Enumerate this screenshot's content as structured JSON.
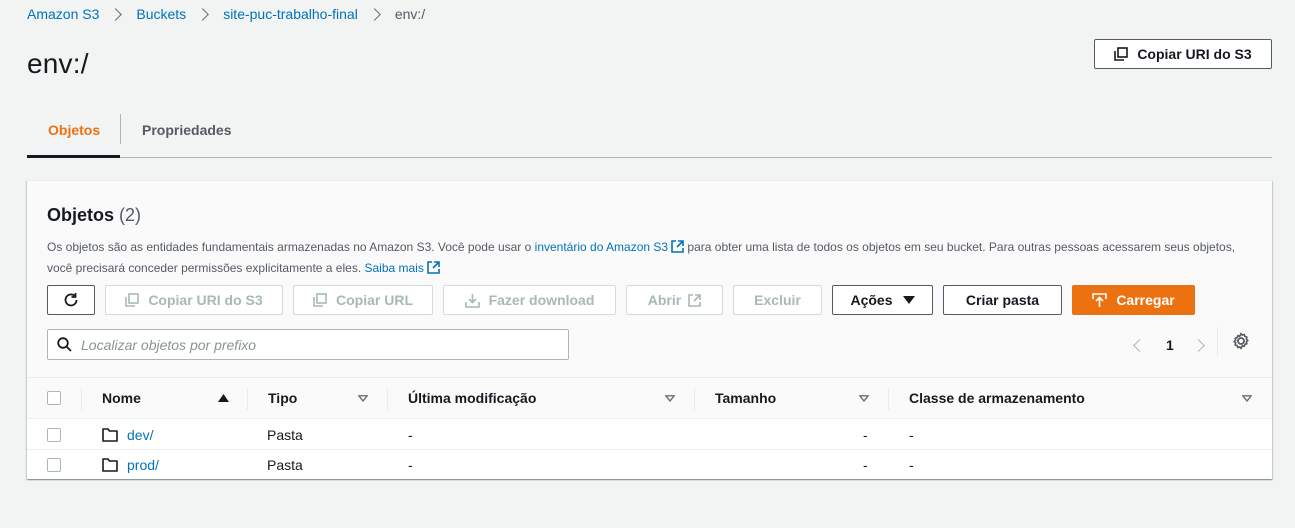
{
  "breadcrumb": {
    "items": [
      "Amazon S3",
      "Buckets",
      "site-puc-trabalho-final"
    ],
    "current": "env:/"
  },
  "header": {
    "title": "env:/",
    "copy_uri_label": "Copiar URI do S3"
  },
  "tabs": [
    {
      "label": "Objetos",
      "active": true
    },
    {
      "label": "Propriedades",
      "active": false
    }
  ],
  "objects_panel": {
    "title": "Objetos",
    "count": "(2)",
    "desc_part1": "Os objetos são as entidades fundamentais armazenadas no Amazon S3. Você pode usar o ",
    "desc_link": "inventário do Amazon S3",
    "desc_part2": " para obter uma lista de todos os objetos em seu bucket. Para outras pessoas acessarem seus objetos,",
    "desc_part3": "você precisará conceder permissões explicitamente a eles. ",
    "learn_more": "Saiba mais"
  },
  "toolbar": {
    "copy_s3_uri": "Copiar URI do S3",
    "copy_url": "Copiar URL",
    "download": "Fazer download",
    "open": "Abrir",
    "delete": "Excluir",
    "actions": "Ações",
    "create_folder": "Criar pasta",
    "upload": "Carregar"
  },
  "search": {
    "placeholder": "Localizar objetos por prefixo"
  },
  "pagination": {
    "page": "1"
  },
  "table": {
    "columns": [
      "Nome",
      "Tipo",
      "Última modificação",
      "Tamanho",
      "Classe de armazenamento"
    ],
    "rows": [
      {
        "name": "dev/",
        "type": "Pasta",
        "modified": "-",
        "size": "-",
        "storage_class": "-"
      },
      {
        "name": "prod/",
        "type": "Pasta",
        "modified": "-",
        "size": "-",
        "storage_class": "-"
      }
    ]
  },
  "colors": {
    "link": "#0073bb",
    "accent": "#ec7211",
    "text": "#16191f",
    "muted": "#545b64"
  }
}
